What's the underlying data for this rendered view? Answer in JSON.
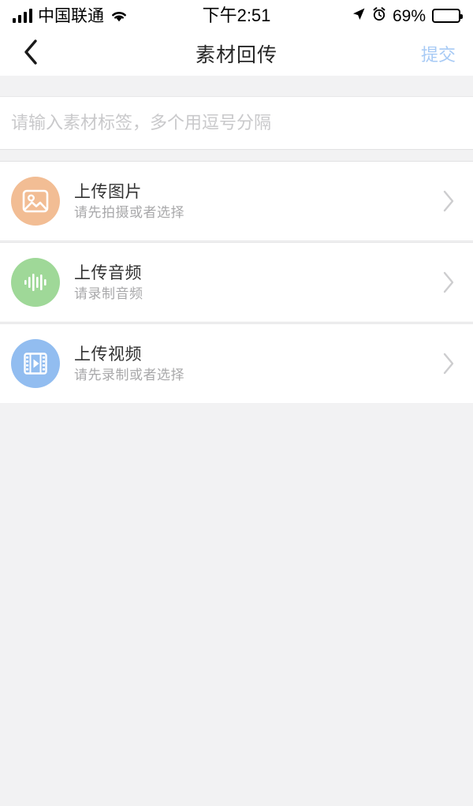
{
  "status_bar": {
    "carrier": "中国联通",
    "wifi_icon": "wifi-icon",
    "signal_icon": "signal-bars-icon",
    "time": "下午2:51",
    "location_icon": "location-arrow-icon",
    "alarm_icon": "alarm-clock-icon",
    "battery_percent": "69%",
    "battery_level": 69
  },
  "nav_bar": {
    "back_icon": "chevron-left-icon",
    "title": "素材回传",
    "action_label": "提交",
    "action_color": "#a7caf5"
  },
  "tag_input": {
    "placeholder": "请输入素材标签，多个用逗号分隔",
    "value": ""
  },
  "upload_rows": [
    {
      "title": "上传图片",
      "subtitle": "请先拍摄或者选择",
      "icon": "image-photo-icon",
      "icon_color": "#f2bd94",
      "chevron_icon": "chevron-right-icon"
    },
    {
      "title": "上传音频",
      "subtitle": "请录制音频",
      "icon": "audio-waveform-icon",
      "icon_color": "#9fd898",
      "chevron_icon": "chevron-right-icon"
    },
    {
      "title": "上传视频",
      "subtitle": "请先录制或者选择",
      "icon": "video-film-play-icon",
      "icon_color": "#92bdf0",
      "chevron_icon": "chevron-right-icon"
    }
  ]
}
